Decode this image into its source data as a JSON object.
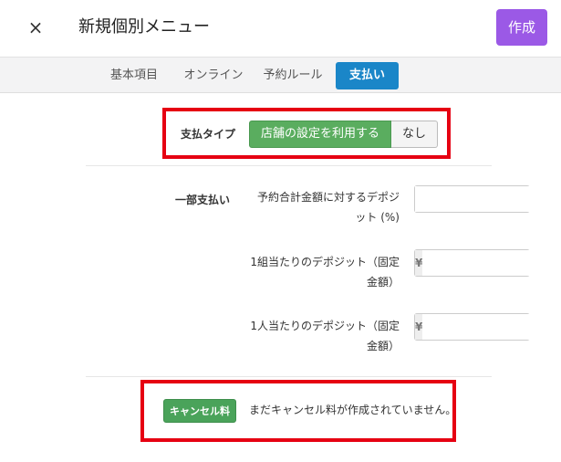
{
  "header": {
    "close_label": "×",
    "title": "新規個別メニュー",
    "create_label": "作成"
  },
  "tabs": [
    {
      "label": "基本項目",
      "active": false
    },
    {
      "label": "オンライン",
      "active": false
    },
    {
      "label": "予約ルール",
      "active": false
    },
    {
      "label": "支払い",
      "active": true
    }
  ],
  "payment_type": {
    "label": "支払タイプ",
    "options": [
      "店舗の設定を利用する",
      "なし"
    ],
    "selected": "店舗の設定を利用する"
  },
  "partial_payment": {
    "label": "一部支払い",
    "fields": [
      {
        "label_line1": "予約合計金額に対するデポジ",
        "label_line2": "ット (%)",
        "addon": "%",
        "addon_side": "right",
        "value": ""
      },
      {
        "label_line1": "1組当たりのデポジット（固定",
        "label_line2": "金額）",
        "addon": "¥",
        "addon_side": "left",
        "value": ""
      },
      {
        "label_line1": "1人当たりのデポジット（固定",
        "label_line2": "金額）",
        "addon": "¥",
        "addon_side": "left",
        "value": ""
      }
    ]
  },
  "cancellation": {
    "button_label": "キャンセル料",
    "message": "まだキャンセル料が作成されていません。"
  },
  "colors": {
    "accent_purple": "#9b59e6",
    "active_tab_blue": "#1a86c8",
    "selected_green": "#5aad5f",
    "highlight_red": "#e60012"
  }
}
